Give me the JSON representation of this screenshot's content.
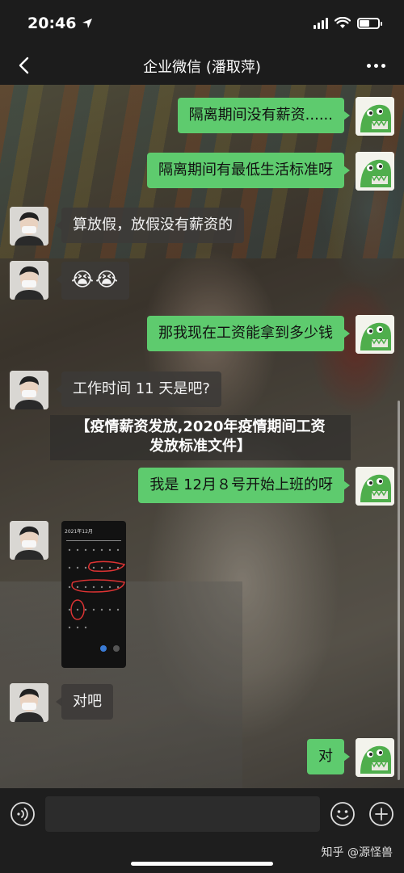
{
  "status": {
    "time": "20:46"
  },
  "nav": {
    "title": "企业微信 (潘取萍)"
  },
  "messages": [
    {
      "side": "me",
      "text": "隔离期间没有薪资......"
    },
    {
      "side": "me",
      "text": "隔离期间有最低生活标准呀"
    },
    {
      "side": "other",
      "text": "算放假，放假没有薪资的"
    },
    {
      "side": "other",
      "text": "😭😭"
    },
    {
      "side": "me",
      "text": "那我现在工资能拿到多少钱"
    },
    {
      "side": "other",
      "text": "工作时间 11 天是吧?"
    },
    {
      "side": "me",
      "text": "我是 12月８号开始上班的呀"
    },
    {
      "side": "other",
      "text": ""
    },
    {
      "side": "other",
      "text": "对吧"
    },
    {
      "side": "me",
      "text": "对"
    }
  ],
  "calendar_image": {
    "month_label": "2021年12月"
  },
  "banner": {
    "line1": "【疫情薪资发放,2020年疫情期间工资",
    "line2": "发放标准文件】"
  },
  "input": {
    "placeholder": ""
  },
  "watermark": "知乎 @源怪兽",
  "colors": {
    "my_bubble": "#5ecb6e",
    "other_bubble": "#3c3a38",
    "bar_bg": "#1c1c1c"
  }
}
